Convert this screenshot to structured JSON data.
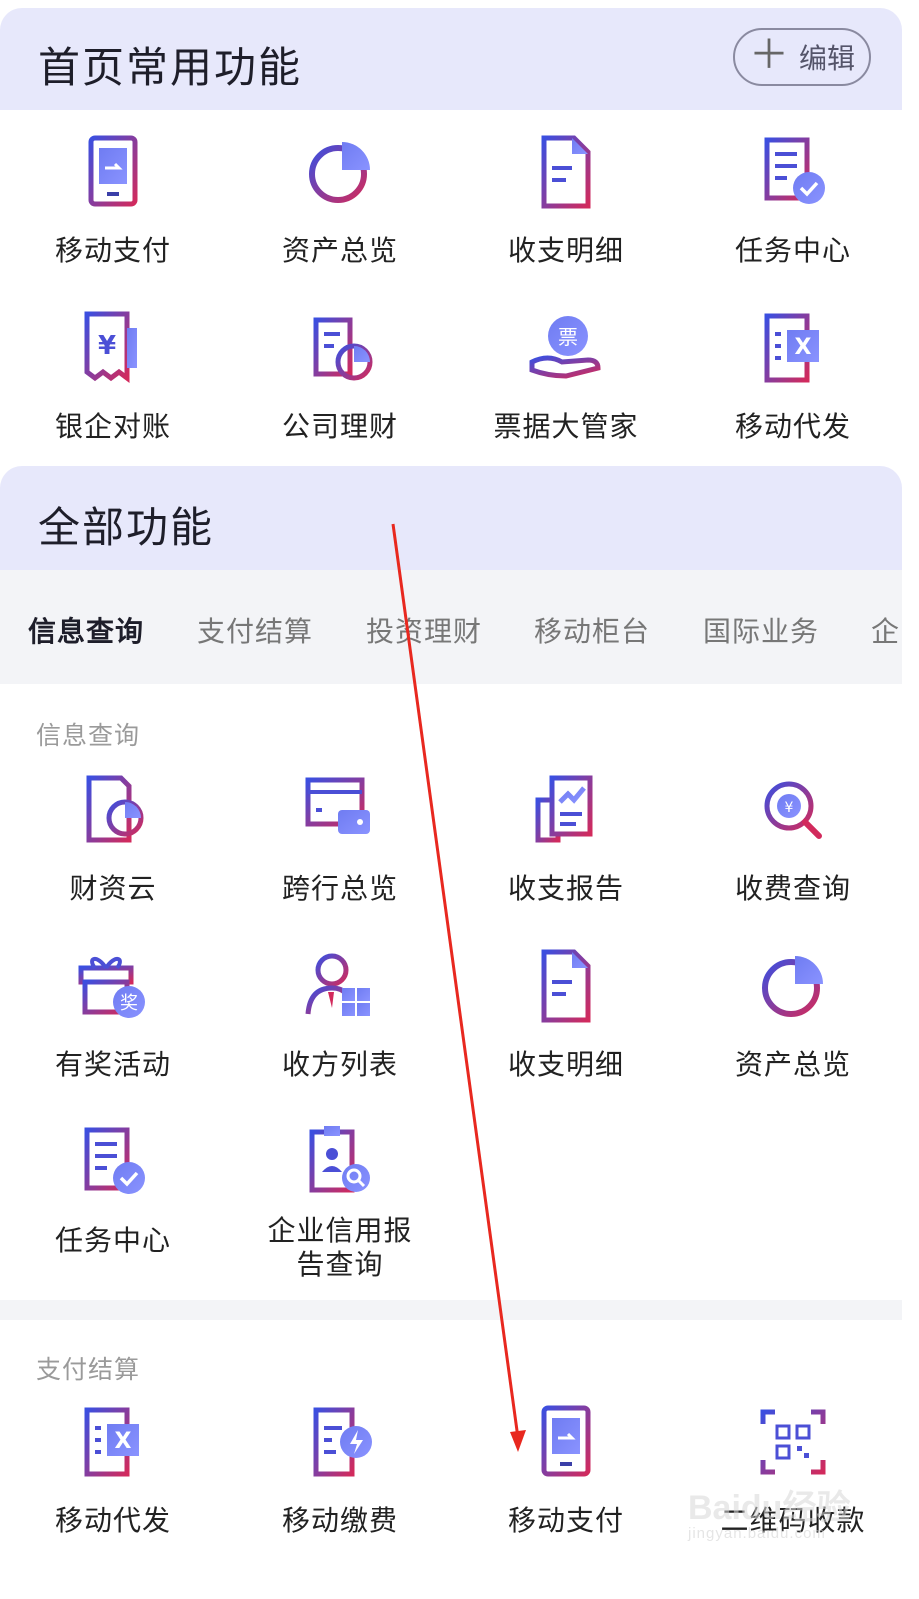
{
  "home_section": {
    "title": "首页常用功能",
    "edit_label": "编辑",
    "items": [
      {
        "label": "移动支付",
        "icon": "mobile-pay-icon"
      },
      {
        "label": "资产总览",
        "icon": "pie-chart-icon"
      },
      {
        "label": "收支明细",
        "icon": "document-icon"
      },
      {
        "label": "任务中心",
        "icon": "task-check-icon"
      },
      {
        "label": "银企对账",
        "icon": "yuan-receipt-icon"
      },
      {
        "label": "公司理财",
        "icon": "finance-doc-icon"
      },
      {
        "label": "票据大管家",
        "icon": "bill-hand-icon"
      },
      {
        "label": "移动代发",
        "icon": "excel-doc-icon"
      }
    ]
  },
  "all_section": {
    "title": "全部功能",
    "tabs": [
      "信息查询",
      "支付结算",
      "投资理财",
      "移动柜台",
      "国际业务",
      "企"
    ],
    "active_tab": "信息查询"
  },
  "info_query": {
    "label": "信息查询",
    "items": [
      {
        "label": "财资云",
        "icon": "cloud-doc-icon"
      },
      {
        "label": "跨行总览",
        "icon": "wallet-card-icon"
      },
      {
        "label": "收支报告",
        "icon": "report-chart-icon"
      },
      {
        "label": "收费查询",
        "icon": "yuan-search-icon"
      },
      {
        "label": "有奖活动",
        "icon": "gift-icon"
      },
      {
        "label": "收方列表",
        "icon": "user-grid-icon"
      },
      {
        "label": "收支明细",
        "icon": "document-icon"
      },
      {
        "label": "资产总览",
        "icon": "pie-chart-icon"
      },
      {
        "label": "任务中心",
        "icon": "task-check-icon"
      },
      {
        "label": "企业信用报",
        "label2": "告查询",
        "icon": "credit-report-icon"
      }
    ],
    "gift_badge": "奖",
    "yuan_glyph": "¥",
    "x_glyph": "X"
  },
  "pay_settle": {
    "label": "支付结算",
    "items": [
      {
        "label": "移动代发",
        "icon": "excel-doc-icon"
      },
      {
        "label": "移动缴费",
        "icon": "lightning-doc-icon"
      },
      {
        "label": "移动支付",
        "icon": "mobile-pay-icon"
      },
      {
        "label": "二维码收款",
        "icon": "qr-code-icon"
      }
    ]
  },
  "ticket_glyph": "票",
  "watermark": {
    "brand": "Baidu经验",
    "url": "jingyan.baidu.com"
  },
  "colors": {
    "accent_blue": "#4b4fd6",
    "accent_purple": "#8b3ea8",
    "accent_red": "#d12e5a",
    "header_bg": "#e7e8fb",
    "arrow_red": "#e8281f"
  }
}
